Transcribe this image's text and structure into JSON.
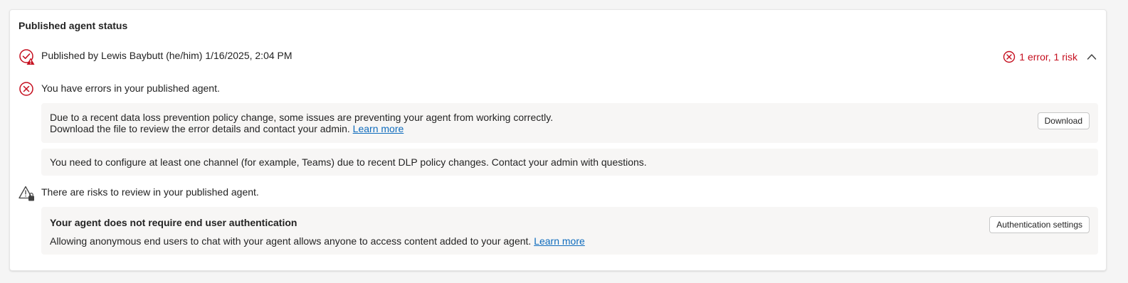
{
  "card": {
    "title": "Published agent status"
  },
  "publish_info": {
    "text": "Published by Lewis Baybutt (he/him) 1/16/2025, 2:04 PM",
    "status_summary": "1 error, 1 risk"
  },
  "errors": {
    "heading": "You have errors in your published agent.",
    "items": [
      {
        "line1": "Due to a recent data loss prevention policy change, some issues are preventing your agent from working correctly.",
        "line2": "Download the file to review the error details and contact your admin.",
        "link": "Learn more",
        "button": "Download"
      },
      {
        "line1": "You need to configure at least one channel (for example, Teams) due to recent DLP policy changes. Contact your admin with questions."
      }
    ]
  },
  "risks": {
    "heading": "There are risks to review in your published agent.",
    "items": [
      {
        "title": "Your agent does not require end user authentication",
        "text": "Allowing anonymous end users to chat with your agent allows anyone to access content added to your agent.",
        "link": "Learn more",
        "button": "Authentication settings"
      }
    ]
  },
  "icons": {
    "published": "check-circle-warning-icon",
    "error": "error-circle-icon",
    "risk": "warning-triangle-lock-icon",
    "collapse": "chevron-up-icon"
  },
  "colors": {
    "error_red": "#c50f1f",
    "link_blue": "#0f6cbd",
    "panel_bg": "#f7f6f5"
  }
}
